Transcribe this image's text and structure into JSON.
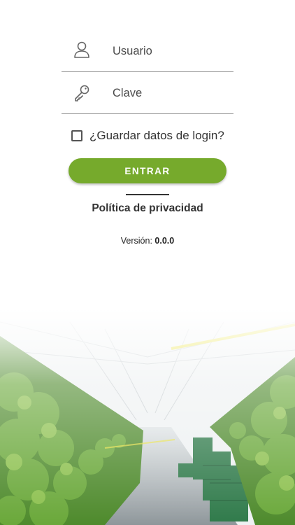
{
  "login": {
    "username_placeholder": "Usuario",
    "password_placeholder": "Clave",
    "remember_label": "¿Guardar datos de login?",
    "remember_checked": false,
    "submit_label": "ENTRAR",
    "privacy_link": "Política de privacidad",
    "version_label": "Versión:",
    "version_value": "0.0.0"
  },
  "icons": {
    "username": "user-icon",
    "password": "key-icon"
  },
  "colors": {
    "accent_green": "#76aa2c",
    "accent_yellow": "#e8e03a",
    "text_dark": "#333333"
  }
}
